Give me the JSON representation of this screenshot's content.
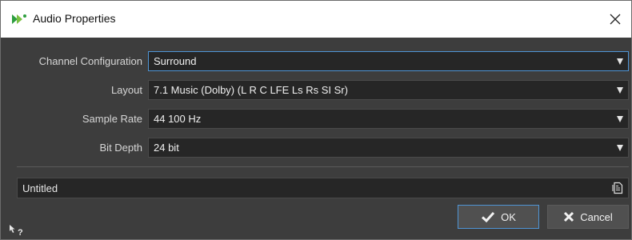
{
  "window": {
    "title": "Audio Properties",
    "accent_color": "#4f95d6",
    "background_color": "#3d3d3d"
  },
  "fields": {
    "channel_configuration": {
      "label": "Channel Configuration",
      "value": "Surround"
    },
    "layout": {
      "label": "Layout",
      "value": "7.1 Music (Dolby) (L R C LFE Ls Rs SI Sr)"
    },
    "sample_rate": {
      "label": "Sample Rate",
      "value": "44 100 Hz"
    },
    "bit_depth": {
      "label": "Bit Depth",
      "value": "24 bit"
    }
  },
  "preset": {
    "name": "Untitled",
    "icon": "presets-icon"
  },
  "buttons": {
    "ok_label": "OK",
    "cancel_label": "Cancel"
  },
  "icons": {
    "app": "app-logo-icon",
    "close": "close-icon",
    "ok": "checkmark-icon",
    "cancel": "x-icon",
    "help": "help-pointer-icon"
  }
}
